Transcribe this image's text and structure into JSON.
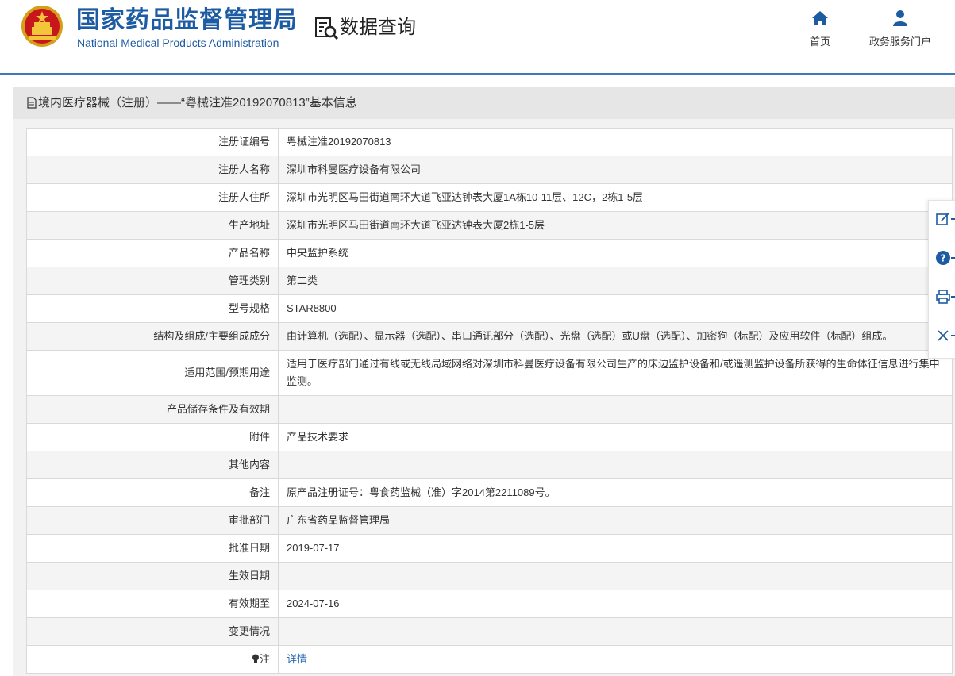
{
  "header": {
    "org_cn": "国家药品监督管理局",
    "org_en": "National Medical Products Administration",
    "section_title": "数据查询",
    "nav": [
      {
        "label": "首页",
        "icon": "home-icon"
      },
      {
        "label": "政务服务门户",
        "icon": "user-icon"
      }
    ]
  },
  "panel": {
    "title": "境内医疗器械（注册）——“粤械注准20192070813”基本信息"
  },
  "rows": [
    {
      "key": "注册证编号",
      "value": "粤械注准20192070813"
    },
    {
      "key": "注册人名称",
      "value": "深圳市科曼医疗设备有限公司"
    },
    {
      "key": "注册人住所",
      "value": "深圳市光明区马田街道南环大道飞亚达钟表大厦1A栋10-11层、12C，2栋1-5层"
    },
    {
      "key": "生产地址",
      "value": "深圳市光明区马田街道南环大道飞亚达钟表大厦2栋1-5层"
    },
    {
      "key": "产品名称",
      "value": "中央监护系统"
    },
    {
      "key": "管理类别",
      "value": "第二类"
    },
    {
      "key": "型号规格",
      "value": "STAR8800"
    },
    {
      "key": "结构及组成/主要组成成分",
      "value": "由计算机（选配）、显示器（选配）、串口通讯部分（选配）、光盘（选配）或U盘（选配）、加密狗（标配）及应用软件（标配）组成。"
    },
    {
      "key": "适用范围/预期用途",
      "value": "适用于医疗部门通过有线或无线局域网络对深圳市科曼医疗设备有限公司生产的床边监护设备和/或遥测监护设备所获得的生命体征信息进行集中监测。"
    },
    {
      "key": "产品储存条件及有效期",
      "value": ""
    },
    {
      "key": "附件",
      "value": "产品技术要求"
    },
    {
      "key": "其他内容",
      "value": ""
    },
    {
      "key": "备注",
      "value": "原产品注册证号：粤食药监械（准）字2014第2211089号。"
    },
    {
      "key": "审批部门",
      "value": "广东省药品监督管理局"
    },
    {
      "key": "批准日期",
      "value": "2019-07-17"
    },
    {
      "key": "生效日期",
      "value": ""
    },
    {
      "key": "有效期至",
      "value": "2024-07-16"
    },
    {
      "key": "变更情况",
      "value": ""
    }
  ],
  "note_row": {
    "key": "注",
    "link": "详情"
  },
  "side_tools": [
    {
      "icon": "edit-icon"
    },
    {
      "icon": "help-icon"
    },
    {
      "icon": "print-icon"
    },
    {
      "icon": "close-icon"
    }
  ],
  "colors": {
    "brand": "#1d5ba3",
    "accent_line": "#3f7ab8",
    "link": "#2b6cb3"
  }
}
